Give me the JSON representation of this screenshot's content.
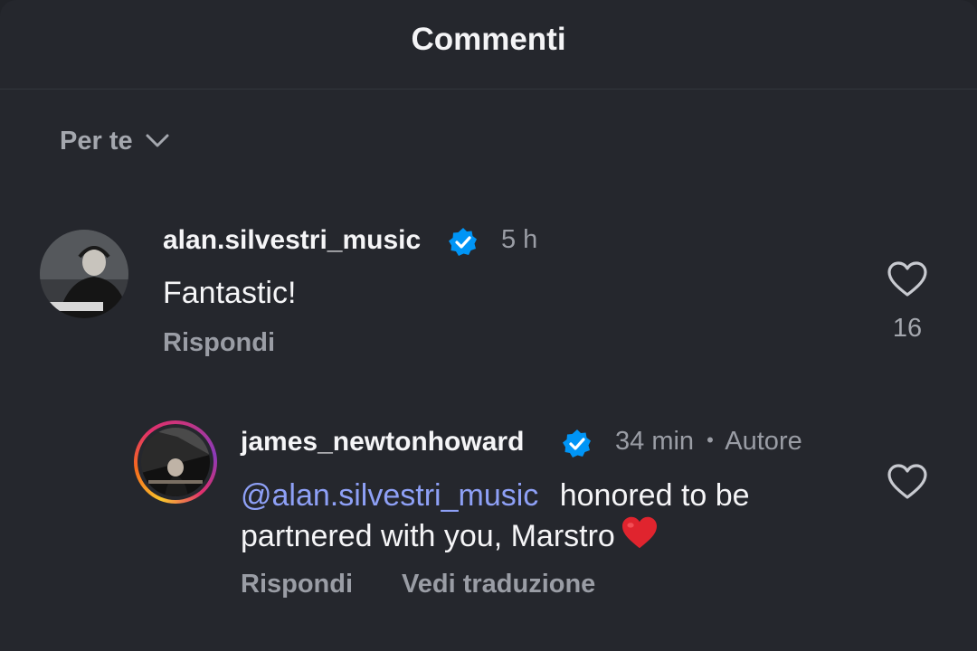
{
  "header": {
    "title": "Commenti"
  },
  "sort": {
    "label": "Per te"
  },
  "comments": [
    {
      "username": "alan.silvestri_music",
      "verified": true,
      "time": "5 h",
      "text": "Fantastic!",
      "reply_label": "Rispondi",
      "likes": "16"
    }
  ],
  "reply": {
    "username": "james_newtonhoward",
    "verified": true,
    "time": "34 min",
    "separator": "•",
    "author_badge": "Autore",
    "mention": "@alan.silvestri_music",
    "text_line1": " honored to be",
    "text_line2": "partnered with you, Marstro",
    "reply_label": "Rispondi",
    "translate_label": "Vedi traduzione"
  },
  "colors": {
    "background": "#25272d",
    "mention": "#8ea0f6",
    "verified": "#0095f6",
    "heart_emoji": "#e0242e"
  },
  "icons": [
    "chevron-down-icon",
    "verified-badge-icon",
    "heart-outline-icon",
    "red-heart-emoji-icon",
    "threads-at-icon"
  ]
}
